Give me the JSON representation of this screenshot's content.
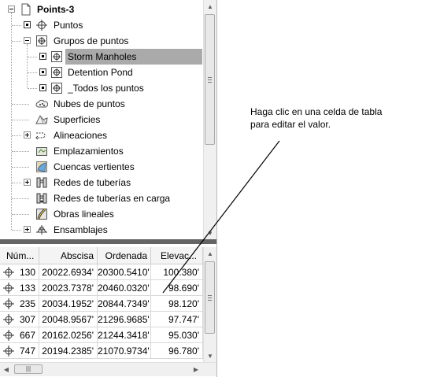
{
  "tree": {
    "root": {
      "label": "Points-3",
      "icon": "drawing-icon"
    },
    "items": [
      {
        "label": "Puntos",
        "icon": "point-icon"
      },
      {
        "label": "Grupos de puntos",
        "icon": "point-group-icon"
      },
      {
        "label": "Storm Manholes",
        "icon": "point-group-icon",
        "selected": true
      },
      {
        "label": "Detention Pond",
        "icon": "point-group-icon"
      },
      {
        "label": "_Todos los puntos",
        "icon": "point-group-icon"
      },
      {
        "label": "Nubes de puntos",
        "icon": "point-cloud-icon"
      },
      {
        "label": "Superficies",
        "icon": "surface-icon"
      },
      {
        "label": "Alineaciones",
        "icon": "alignment-icon"
      },
      {
        "label": "Emplazamientos",
        "icon": "site-icon"
      },
      {
        "label": "Cuencas vertientes",
        "icon": "catchment-icon"
      },
      {
        "label": "Redes de tuberías",
        "icon": "pipe-network-icon"
      },
      {
        "label": "Redes de tuberías en carga",
        "icon": "pressure-network-icon"
      },
      {
        "label": "Obras lineales",
        "icon": "corridor-icon"
      },
      {
        "label": "Ensamblajes",
        "icon": "assembly-icon"
      }
    ]
  },
  "table": {
    "columns": [
      "Núm...",
      "Abscisa",
      "Ordenada",
      "Elevac..."
    ],
    "rows": [
      [
        "130",
        "20022.6934'",
        "20300.5410'",
        "100.380'"
      ],
      [
        "133",
        "20023.7378'",
        "20460.0320'",
        "98.690'"
      ],
      [
        "235",
        "20034.1952'",
        "20844.7349'",
        "98.120'"
      ],
      [
        "307",
        "20048.9567'",
        "21296.9685'",
        "97.747'"
      ],
      [
        "667",
        "20162.0256'",
        "21244.3418'",
        "95.030'"
      ],
      [
        "747",
        "20194.2385'",
        "21070.9734'",
        "96.780'"
      ]
    ]
  },
  "annotation": {
    "text_line1": "Haga clic en una celda de tabla",
    "text_line2": "para editar el valor."
  },
  "colors": {
    "selection": "#aaaaaa",
    "splitter": "#646464",
    "callout_line": "#000000"
  }
}
